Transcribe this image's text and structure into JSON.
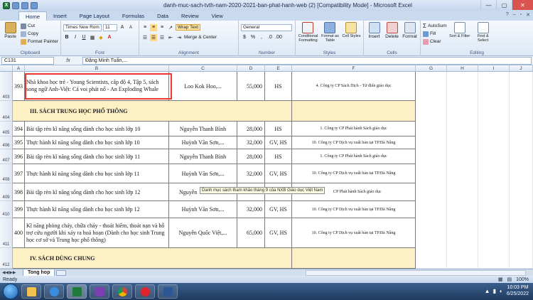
{
  "window": {
    "title": "danh-muc-sach-tvth-nam-2020-2021-ban-phat-hanh-web (2)  [Compatibility Mode] - Microsoft Excel"
  },
  "ribbon_tabs": [
    "Home",
    "Insert",
    "Page Layout",
    "Formulas",
    "Data",
    "Review",
    "View"
  ],
  "ribbon": {
    "clipboard": {
      "paste": "Paste",
      "cut": "Cut",
      "copy": "Copy",
      "format_painter": "Format Painter",
      "label": "Clipboard"
    },
    "font": {
      "name": "Times New Rom",
      "size": "11",
      "label": "Font"
    },
    "alignment": {
      "wrap_text": "Wrap Text",
      "merge": "Merge & Center",
      "label": "Alignment"
    },
    "number": {
      "format": "General",
      "dollar": "$",
      "percent": "%",
      "comma": ",",
      "label": "Number"
    },
    "styles": {
      "conditional": "Conditional Formatting",
      "table": "Format as Table",
      "cell_styles": "Cell Styles",
      "label": "Styles"
    },
    "cells": {
      "insert": "Insert",
      "delete": "Delete",
      "format": "Format",
      "label": "Cells"
    },
    "editing": {
      "autosum": "AutoSum",
      "fill": "Fill",
      "clear": "Clear",
      "sort": "Sort & Filter",
      "find": "Find & Select",
      "label": "Editing"
    }
  },
  "formula_bar": {
    "name_box": "C131",
    "fx": "fx",
    "formula": "Đặng Minh Tuấn,..."
  },
  "columns": [
    "A",
    "B",
    "C",
    "D",
    "E",
    "F",
    "G",
    "H",
    "I",
    "J"
  ],
  "rows": [
    {
      "row": "403",
      "a": "393",
      "b": "Nhà khoa học trẻ - Young Scientists, cấp độ 4, Tập 5, sách song ngữ Anh-Việt: Cá voi phát nổ - An Exploding Whale",
      "c": "Loo Kok Hoo,...",
      "d": "55,000",
      "e": "HS",
      "f": "4. Công ty CP Sách Dịch - Từ điển giáo dục"
    },
    {
      "row": "404",
      "section": "III. SÁCH TRUNG HỌC PHỔ THÔNG"
    },
    {
      "row": "405",
      "a": "394",
      "b": "Bài tập rèn kĩ năng sống dành cho học sinh lớp 10",
      "c": "Nguyễn Thanh Bình",
      "d": "28,000",
      "e": "HS",
      "f": "1. Công ty CP Phát hành Sách giáo dục"
    },
    {
      "row": "406",
      "a": "395",
      "b": "Thực hành kĩ năng sống dành cho học sinh lớp 10",
      "c": "Huỳnh Văn Sơn,...",
      "d": "32,000",
      "e": "GV, HS",
      "f": "10. Công ty CP Dịch vụ xuất bản tại TP.Đà Nẵng"
    },
    {
      "row": "407",
      "a": "396",
      "b": "Bài tập rèn kĩ năng sống dành cho học sinh lớp 11",
      "c": "Nguyễn Thanh Bình",
      "d": "28,000",
      "e": "HS",
      "f": "1. Công ty CP Phát hành Sách giáo dục"
    },
    {
      "row": "408",
      "a": "397",
      "b": "Thực hành kĩ năng sống dành cho học sinh lớp 11",
      "c": "Huỳnh Văn Sơn,...",
      "d": "32,000",
      "e": "GV, HS",
      "f": "10. Công ty CP Dịch vụ xuất bản tại TP.Đà Nẵng"
    },
    {
      "row": "409",
      "a": "398",
      "b": "Bài tập rèn kĩ năng sống dành cho học sinh lớp 12",
      "c": "Nguyễn",
      "d": "",
      "e": "",
      "f": "CP Phát hành Sách giáo dục"
    },
    {
      "row": "410",
      "a": "399",
      "b": "Thực hành kĩ năng sống dành cho học sinh lớp 12",
      "c": "Huỳnh Văn Sơn,...",
      "d": "32,000",
      "e": "GV, HS",
      "f": "10. Công ty CP Dịch vụ xuất bản tại TP.Đà Nẵng"
    },
    {
      "row": "411",
      "a": "400",
      "b": "Kĩ năng phòng cháy, chữa cháy - thoát hiểm, thoát nạn và hỗ trợ cứu người khi xảy ra hoả hoạn (Dành cho học sinh Trung học cơ sở và Trung học phổ thông)",
      "c": "Nguyễn Quốc Việt,...",
      "d": "65,000",
      "e": "GV, HS",
      "f": "10. Công ty CP Dịch vụ xuất bản tại TP.Đà Nẵng"
    },
    {
      "row": "412",
      "section": "IV. SÁCH DÙNG CHUNG"
    }
  ],
  "tooltip": "Danh mục sách tham khảo tháng 9 của NXB Giáo dục Việt Nam",
  "sheet_tab": "Tong hop",
  "status": {
    "ready": "Ready",
    "zoom": "100%"
  },
  "taskbar": {
    "time": "10:03 PM",
    "date": "6/25/2022"
  }
}
